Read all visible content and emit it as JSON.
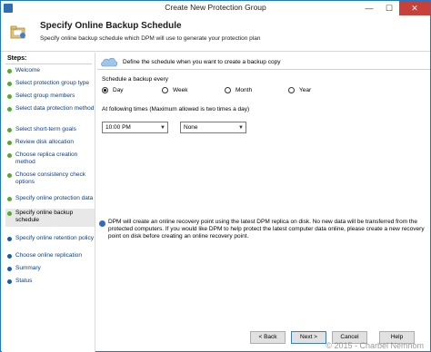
{
  "window": {
    "title": "Create New Protection Group",
    "minimize_glyph": "—",
    "maximize_glyph": "☐",
    "close_glyph": "✕"
  },
  "header": {
    "title": "Specify Online Backup Schedule",
    "subtitle": "Specify online backup schedule which DPM will use to generate your protection plan",
    "icon": "folder-wizard-icon"
  },
  "steps": {
    "title": "Steps:",
    "items": [
      {
        "label": "Welcome",
        "state": "done"
      },
      {
        "label": "Select protection group type",
        "state": "done"
      },
      {
        "label": "Select group members",
        "state": "done"
      },
      {
        "label": "Select data protection method",
        "state": "done"
      },
      {
        "label": "Select short-term goals",
        "state": "done"
      },
      {
        "label": "Review disk allocation",
        "state": "done"
      },
      {
        "label": "Choose replica creation method",
        "state": "done"
      },
      {
        "label": "Choose consistency check options",
        "state": "done"
      },
      {
        "label": "Specify online protection data",
        "state": "done"
      },
      {
        "label": "Specify online backup schedule",
        "state": "current"
      },
      {
        "label": "Specify online retention policy",
        "state": "pending"
      },
      {
        "label": "Choose online replication",
        "state": "pending"
      },
      {
        "label": "Summary",
        "state": "pending"
      },
      {
        "label": "Status",
        "state": "pending"
      }
    ]
  },
  "main": {
    "define_text": "Define the schedule when you want to create a backup copy",
    "schedule_label": "Schedule a backup every",
    "frequency_options": [
      {
        "label": "Day",
        "checked": true
      },
      {
        "label": "Week",
        "checked": false
      },
      {
        "label": "Month",
        "checked": false
      },
      {
        "label": "Year",
        "checked": false
      }
    ],
    "times_label": "At following times (Maximum allowed is two times a day)",
    "time_1": "10:00 PM",
    "time_2": "None",
    "note": "DPM will create an online recovery point using the latest DPM replica on disk. No new data will be transferred from the protected computers. If you would like DPM to help protect the latest computer data online, please create a new recovery point on disk before creating an online recovery point."
  },
  "buttons": {
    "back": "< Back",
    "next": "Next >",
    "cancel": "Cancel",
    "help": "Help"
  },
  "watermark": "© 2015 - Charbel Nemnom",
  "colors": {
    "done_dot": "#55a930",
    "pending_dot": "#1c5aa8",
    "close_button": "#c7413a",
    "link_text": "#0a3d8f"
  }
}
